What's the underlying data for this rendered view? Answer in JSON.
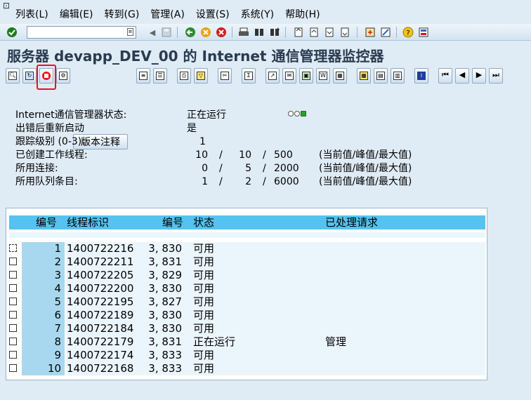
{
  "menubar": {
    "items": [
      "列表(L)",
      "编辑(E)",
      "转到(G)",
      "管理(A)",
      "设置(S)",
      "系统(Y)",
      "帮助(H)"
    ]
  },
  "toolbar": {
    "command_value": "",
    "icons": [
      "enter-icon",
      "back-icon",
      "exit-icon",
      "cancel-icon",
      "print-icon",
      "find-icon",
      "find-next-icon",
      "first-page-icon",
      "prev-page-icon",
      "next-page-icon",
      "last-page-icon",
      "new-session-icon",
      "shortcut-icon",
      "help-icon",
      "layout-icon"
    ]
  },
  "title": "服务器 devapp_DEV_00 的 Internet 通信管理器监控器",
  "toolbar2": {
    "version_label": "版本注释"
  },
  "status": {
    "rows": [
      {
        "label": "Internet通信管理器状态:",
        "value": "正在运行"
      },
      {
        "label": "出错后重新启动",
        "value": "是"
      },
      {
        "label": "跟踪级别 (0-3):",
        "value": "1"
      },
      {
        "label": "已创建工作线程:",
        "v1": "10",
        "v2": "10",
        "v3": "500",
        "note": "(当前值/峰值/最大值)"
      },
      {
        "label": "所用连接:",
        "v1": "0",
        "v2": "5",
        "v3": "2000",
        "note": "(当前值/峰值/最大值)"
      },
      {
        "label": "所用队列条目:",
        "v1": "1",
        "v2": "2",
        "v3": "6000",
        "note": "(当前值/峰值/最大值)"
      }
    ],
    "separator": "/",
    "status_colors": {
      "green": "#2ca02c"
    }
  },
  "table": {
    "headers": {
      "no": "编号",
      "thread_id": "线程标识",
      "no2": "编号",
      "status": "状态",
      "requests": "已处理请求"
    },
    "rows": [
      {
        "no": "1",
        "thread_id": "1400722216",
        "no2": "3, 830",
        "status": "可用",
        "requests": ""
      },
      {
        "no": "2",
        "thread_id": "1400722211",
        "no2": "3, 831",
        "status": "可用",
        "requests": ""
      },
      {
        "no": "3",
        "thread_id": "1400722205",
        "no2": "3, 829",
        "status": "可用",
        "requests": ""
      },
      {
        "no": "4",
        "thread_id": "1400722200",
        "no2": "3, 830",
        "status": "可用",
        "requests": ""
      },
      {
        "no": "5",
        "thread_id": "1400722195",
        "no2": "3, 827",
        "status": "可用",
        "requests": ""
      },
      {
        "no": "6",
        "thread_id": "1400722189",
        "no2": "3, 830",
        "status": "可用",
        "requests": ""
      },
      {
        "no": "7",
        "thread_id": "1400722184",
        "no2": "3, 830",
        "status": "可用",
        "requests": ""
      },
      {
        "no": "8",
        "thread_id": "1400722179",
        "no2": "3, 831",
        "status": "正在运行",
        "requests": "管理"
      },
      {
        "no": "9",
        "thread_id": "1400722174",
        "no2": "3, 833",
        "status": "可用",
        "requests": ""
      },
      {
        "no": "10",
        "thread_id": "1400722168",
        "no2": "3, 833",
        "status": "可用",
        "requests": ""
      }
    ]
  }
}
